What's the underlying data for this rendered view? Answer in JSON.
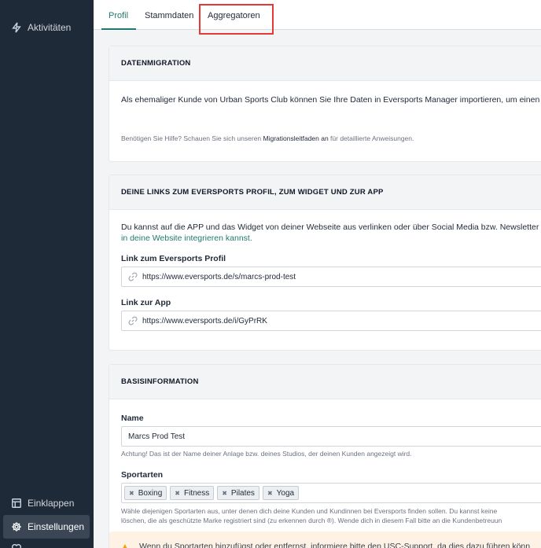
{
  "sidebar": {
    "items": [
      {
        "label": "Aktivitäten",
        "icon": "bolt-icon"
      },
      {
        "label": "Einklappen",
        "icon": "collapse-icon"
      },
      {
        "label": "Einstellungen",
        "icon": "gear-icon"
      }
    ]
  },
  "tabs": [
    {
      "label": "Profil",
      "active": true
    },
    {
      "label": "Stammdaten",
      "active": false
    },
    {
      "label": "Aggregatoren",
      "active": false
    }
  ],
  "migration": {
    "heading": "DATENMIGRATION",
    "text": "Als ehemaliger Kunde von Urban Sports Club können Sie Ihre Daten in Eversports Manager importieren, um einen n",
    "help_prefix": "Benötigen Sie Hilfe? Schauen Sie sich unseren ",
    "help_link": "Migrationsleitfaden an",
    "help_suffix": " für detaillierte Anweisungen."
  },
  "links": {
    "heading": "DEINE LINKS ZUM EVERSPORTS PROFIL, ZUM WIDGET UND ZUR APP",
    "text": "Du kannst auf die APP und das Widget von deiner Webseite aus verlinken oder über Social Media bzw. Newsletter te",
    "text_link": "in deine Website integrieren kannst.",
    "profile_label": "Link zum Eversports Profil",
    "profile_url": "https://www.eversports.de/s/marcs-prod-test",
    "app_label": "Link zur App",
    "app_url": "https://www.eversports.de/i/GyPrRK"
  },
  "basis": {
    "heading": "BASISINFORMATION",
    "name_label": "Name",
    "name_value": "Marcs Prod Test",
    "name_hint": "Achtung! Das ist der Name deiner Anlage bzw. deines Studios, der deinen Kunden angezeigt wird.",
    "sports_label": "Sportarten",
    "sports": [
      "Boxing",
      "Fitness",
      "Pilates",
      "Yoga"
    ],
    "sports_hint_1": "Wähle diejenigen Sportarten aus, unter denen dich deine Kunden und Kundinnen bei Eversports finden sollen. Du kannst keine",
    "sports_hint_2": "löschen, die als geschützte Marke registriert sind (zu erkennen durch ®). Wende dich in diesem Fall bitte an die Kundenbetreuun",
    "warning": "Wenn du Sportarten hinzufügst oder entfernst, informiere bitte den USC-Support, da dies dazu führen könn"
  },
  "colors": {
    "sidebar_bg": "#1f2a38",
    "accent": "#1f7a6d",
    "highlight": "#e53935"
  }
}
